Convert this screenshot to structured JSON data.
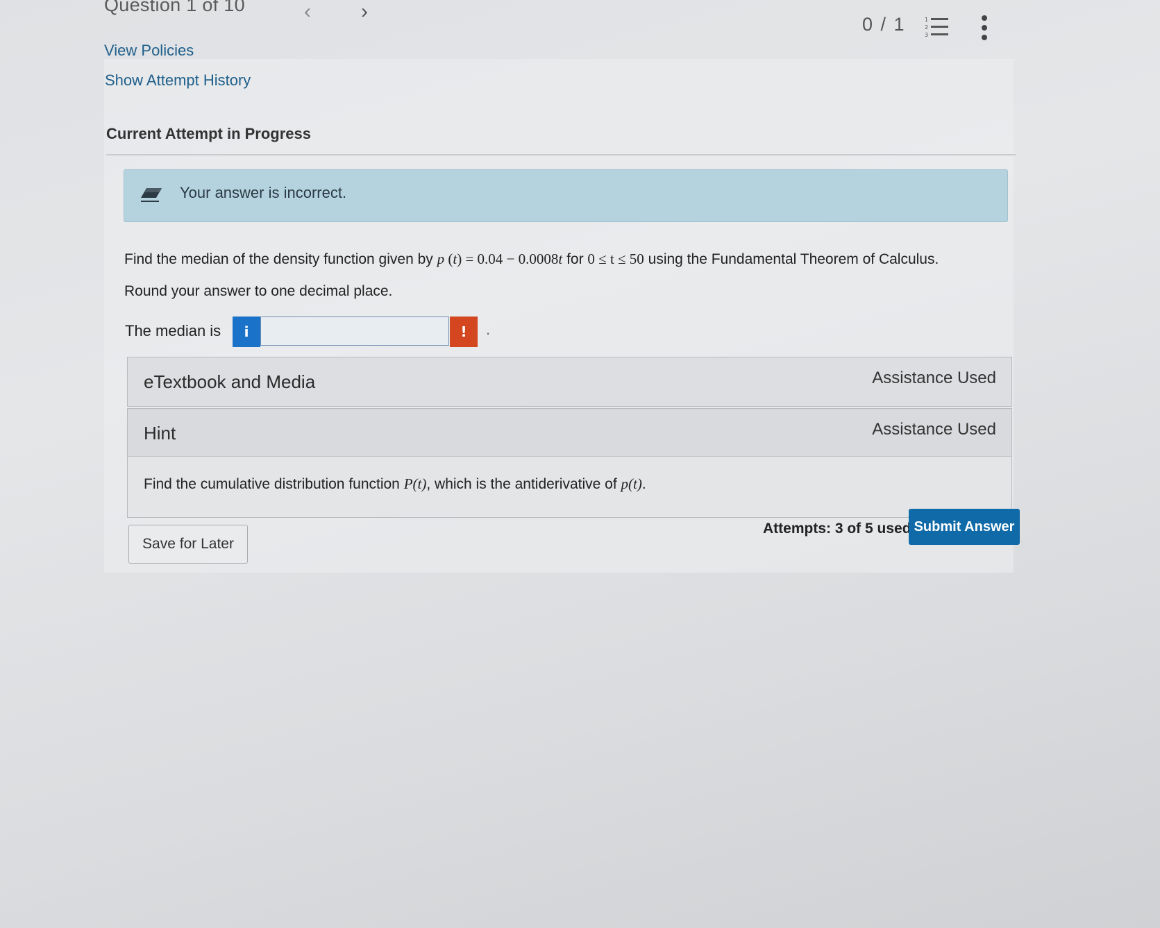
{
  "header": {
    "question_label": "Question 1 of 10",
    "score": "0 / 1",
    "prev_icon": "chevron-left-icon",
    "next_icon": "chevron-right-icon",
    "list_icon": "numbered-list-icon",
    "more_icon": "kebab-menu-icon"
  },
  "links": {
    "view_policies": "View Policies",
    "show_attempt_history": "Show Attempt History"
  },
  "section_title": "Current Attempt in Progress",
  "alert": {
    "icon": "eraser-icon",
    "text": "Your answer is incorrect.",
    "color": "#b5d3df"
  },
  "question": {
    "prefix": "Find the median of the density function given by ",
    "func_name": "p",
    "func_arg": "t",
    "func_body": "0.04 − 0.0008",
    "func_var": "t",
    "word_for": " for ",
    "domain": "0 ≤ t ≤ 50",
    "suffix": " using the Fundamental Theorem of Calculus.",
    "instruction": "Round your answer to one decimal place."
  },
  "answer": {
    "label": "The median is",
    "info_glyph": "i",
    "value": "",
    "error_glyph": "!",
    "trailing": "."
  },
  "etextbook": {
    "title": "eTextbook and Media",
    "status": "Assistance Used"
  },
  "hint": {
    "title": "Hint",
    "status": "Assistance Used",
    "body_prefix": "Find the cumulative distribution function ",
    "body_P": "P(t)",
    "body_mid": ", which is the antiderivative of ",
    "body_p": "p(t)",
    "body_end": "."
  },
  "footer": {
    "save_label": "Save for Later",
    "attempts": "Attempts: 3 of 5 used",
    "submit_label": "Submit Answer"
  },
  "colors": {
    "submit": "#0f6aa7",
    "info": "#1a73c9",
    "error": "#d4461f",
    "link": "#1f5f8b"
  }
}
